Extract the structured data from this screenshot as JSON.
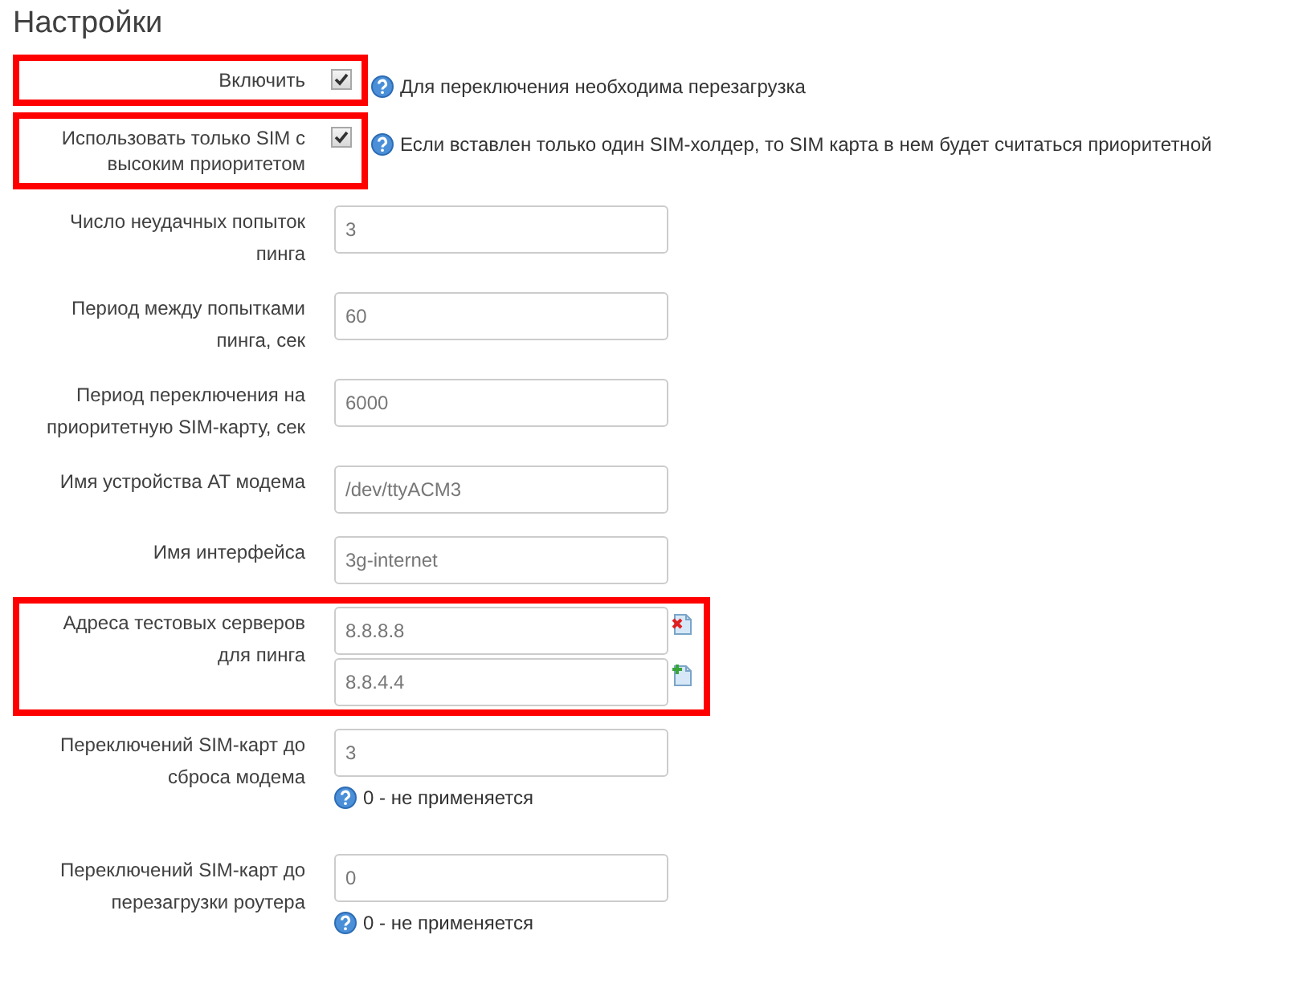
{
  "title": "Настройки",
  "rows": [
    {
      "kind": "checkbox",
      "label": "Включить",
      "checked": true,
      "highlighted": true,
      "hint": "Для переключения необходима перезагрузка"
    },
    {
      "kind": "checkbox",
      "label": "Использовать только SIM с высоким приоритетом",
      "checked": true,
      "highlighted": true,
      "hint": "Если вставлен только один SIM-холдер, то SIM карта в нем будет считаться приоритетной"
    },
    {
      "kind": "text",
      "label": "Число неудачных попыток пинга",
      "value": "3"
    },
    {
      "kind": "text",
      "label": "Период между попытками пинга, сек",
      "value": "60"
    },
    {
      "kind": "text",
      "label": "Период переключения на приоритетную SIM-карту, сек",
      "value": "6000"
    },
    {
      "kind": "text",
      "label": "Имя устройства AT модема",
      "value": "/dev/ttyACM3"
    },
    {
      "kind": "text",
      "label": "Имя интерфейса",
      "value": "3g-internet"
    },
    {
      "kind": "list",
      "label": "Адреса тестовых серверов для пинга",
      "values": [
        "8.8.8.8",
        "8.8.4.4"
      ],
      "highlighted": true
    },
    {
      "kind": "text",
      "label": "Переключений SIM-карт до сброса модема",
      "value": "3",
      "note": "0 - не применяется"
    },
    {
      "kind": "text",
      "label": "Переключений SIM-карт до перезагрузки роутера",
      "value": "0",
      "note": "0 - не применяется"
    }
  ]
}
